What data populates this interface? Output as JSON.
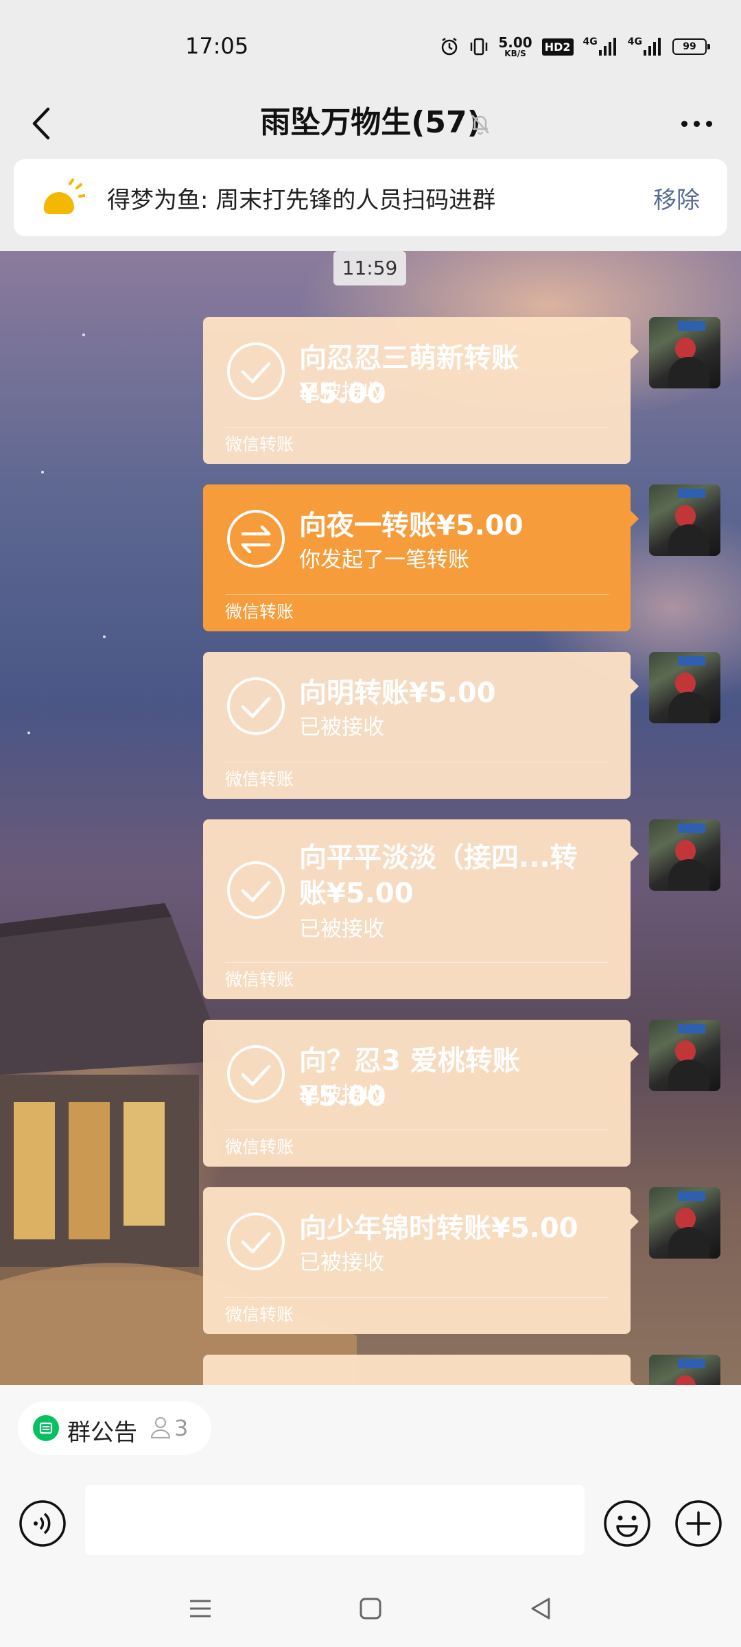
{
  "status_bar": {
    "time": "17:05",
    "speed_value": "5.00",
    "speed_unit": "KB/S",
    "hd_badge": "HD2",
    "sim1_label": "4G",
    "sim2_label": "4G",
    "battery_level": "99"
  },
  "header": {
    "title": "雨坠万物生(57)"
  },
  "pinned_notice": {
    "text": "得梦为鱼: 周末打先锋的人员扫码进群",
    "remove_label": "移除"
  },
  "chat": {
    "time_separator": "11:59",
    "messages": [
      {
        "title": "向忍忍三萌新转账¥5.00",
        "status": "已被接收",
        "footer": "微信转账",
        "state": "received"
      },
      {
        "title": "向夜一转账¥5.00",
        "status": "你发起了一笔转账",
        "footer": "微信转账",
        "state": "pending"
      },
      {
        "title": "向明转账¥5.00",
        "status": "已被接收",
        "footer": "微信转账",
        "state": "received"
      },
      {
        "title": "向平平淡淡（接四...转账¥5.00",
        "status": "已被接收",
        "footer": "微信转账",
        "state": "received"
      },
      {
        "title": "向？忍3  爱桃转账¥5.00",
        "status": "已被接收",
        "footer": "微信转账",
        "state": "received"
      },
      {
        "title": "向少年锦时转账¥5.00",
        "status": "已被接收",
        "footer": "微信转账",
        "state": "received"
      }
    ]
  },
  "quick_bar": {
    "announcement_label": "群公告",
    "member_count": "3"
  },
  "input_bar": {
    "placeholder": ""
  },
  "colors": {
    "pending_bubble": "#f79c3a",
    "received_bubble": "#fce1c4",
    "link": "#576b95",
    "accent_green": "#07c160"
  },
  "icons": [
    "back-arrow-icon",
    "mute-bell-icon",
    "more-icon",
    "sun-icon",
    "check-circle-icon",
    "transfer-arrows-icon",
    "voice-icon",
    "emoji-icon",
    "plus-icon",
    "recent-apps-icon",
    "home-icon",
    "back-triangle-icon"
  ]
}
